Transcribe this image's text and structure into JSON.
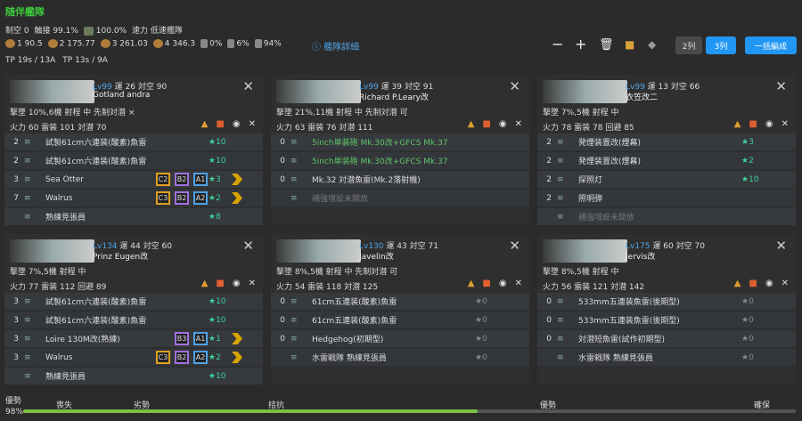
{
  "header": {
    "title": "随伴艦隊",
    "row2": [
      "制空 0",
      "触接 99.1%",
      "100.0%",
      "速力 低速艦隊"
    ],
    "row3": [
      "1 90.5",
      "2 175.77",
      "3 261.03",
      "4 346.3",
      "0%",
      "6%",
      "94%"
    ],
    "row4": [
      "TP 19s / 13A",
      "TP 13s / 9A"
    ],
    "detail": "艦隊詳細",
    "btn_2": "2列",
    "btn_3": "3列",
    "btn_bulk": "一括編成"
  },
  "ships": [
    {
      "lv": "Lv99",
      "luck": "運 26",
      "aa": "対空 90",
      "name": "Gotland andra",
      "st1": "撃墜 10%,6機 射程 中 先制対潜 ×",
      "st2": "火力 60 雷装 101 対潜 70",
      "slots": [
        {
          "n": "2",
          "t": "試製61cm六連装(酸素)魚雷",
          "lv": "★10"
        },
        {
          "n": "2",
          "t": "試製61cm六連装(酸素)魚雷",
          "lv": "★10"
        },
        {
          "n": "3",
          "t": "Sea Otter",
          "lv": "★3",
          "tags": [
            "C2",
            "B2",
            "A1"
          ]
        },
        {
          "n": "7",
          "t": "Walrus",
          "lv": "★2",
          "tags": [
            "C3",
            "B2",
            "A2"
          ]
        },
        {
          "n": "",
          "t": "熟練見張員",
          "lv": "★8"
        }
      ]
    },
    {
      "lv": "Lv99",
      "luck": "運 39",
      "aa": "対空 91",
      "name": "Richard P.Leary改",
      "st1": "撃墜 21%,11機 射程 中 先制対潜 可",
      "st2": "火力 63 雷装 76 対潜 111",
      "slots": [
        {
          "n": "0",
          "t": "5inch単装砲 Mk.30改+GFCS Mk.37",
          "lv": ""
        },
        {
          "n": "0",
          "t": "5inch単装砲 Mk.30改+GFCS Mk.37",
          "lv": ""
        },
        {
          "n": "0",
          "t": "Mk.32 対潜魚雷(Mk.2落射機)",
          "lv": ""
        },
        {
          "n": "",
          "t": "補強増設未開放",
          "lv": ""
        }
      ]
    },
    {
      "lv": "Lv99",
      "luck": "運 13",
      "aa": "対空 66",
      "name": "衣笠改二",
      "st1": "撃墜 7%,5機 射程 中",
      "st2": "火力 78 雷装 78 回避 85",
      "slots": [
        {
          "n": "2",
          "t": "発煙装置改(煙幕)",
          "lv": "★3"
        },
        {
          "n": "2",
          "t": "発煙装置改(煙幕)",
          "lv": "★2"
        },
        {
          "n": "2",
          "t": "探照灯",
          "lv": "★10"
        },
        {
          "n": "2",
          "t": "照明弾",
          "lv": ""
        },
        {
          "n": "",
          "t": "補強増設未開放",
          "lv": ""
        }
      ]
    },
    {
      "lv": "Lv134",
      "luck": "運 44",
      "aa": "対空 60",
      "name": "Prinz Eugen改",
      "st1": "撃墜 7%,5機 射程 中",
      "st2": "火力 77 雷装 112 回避 89",
      "slots": [
        {
          "n": "3",
          "t": "試製61cm六連装(酸素)魚雷",
          "lv": "★10"
        },
        {
          "n": "3",
          "t": "試製61cm六連装(酸素)魚雷",
          "lv": "★10"
        },
        {
          "n": "3",
          "t": "Loire 130M改(熟練)",
          "lv": "★1",
          "tags": [
            "B3",
            "A1"
          ]
        },
        {
          "n": "3",
          "t": "Walrus",
          "lv": "★2",
          "tags": [
            "C3",
            "B2",
            "A2"
          ]
        },
        {
          "n": "",
          "t": "熟練見張員",
          "lv": "★10"
        }
      ]
    },
    {
      "lv": "Lv130",
      "luck": "運 43",
      "aa": "対空 71",
      "name": "Javelin改",
      "st1": "撃墜 8%,5機 射程 中 先制対潜 可",
      "st2": "火力 54 雷装 118 対潜 125",
      "slots": [
        {
          "n": "0",
          "t": "61cm五連装(酸素)魚雷",
          "lv": "★0"
        },
        {
          "n": "0",
          "t": "61cm五連装(酸素)魚雷",
          "lv": "★0"
        },
        {
          "n": "0",
          "t": "Hedgehog(初期型)",
          "lv": "★0"
        },
        {
          "n": "",
          "t": "水雷戦隊 熟練見張員",
          "lv": "★0"
        }
      ]
    },
    {
      "lv": "Lv175",
      "luck": "運 60",
      "aa": "対空 70",
      "name": "Jervis改",
      "st1": "撃墜 8%,5機 射程 中",
      "st2": "火力 56 雷装 121 対潜 142",
      "slots": [
        {
          "n": "0",
          "t": "533mm五連装魚雷(後期型)",
          "lv": "★0"
        },
        {
          "n": "0",
          "t": "533mm五連装魚雷(後期型)",
          "lv": "★0"
        },
        {
          "n": "0",
          "t": "対潜短魚雷(試作初期型)",
          "lv": "★0"
        },
        {
          "n": "",
          "t": "水雷戦隊 熟練見張員",
          "lv": "★0"
        }
      ]
    }
  ],
  "bar": {
    "left1": "優勢",
    "left2": "98%",
    "labels": [
      "喪失",
      "劣勢",
      "拮抗",
      "優勢",
      "確保"
    ],
    "progress": 0.98
  }
}
